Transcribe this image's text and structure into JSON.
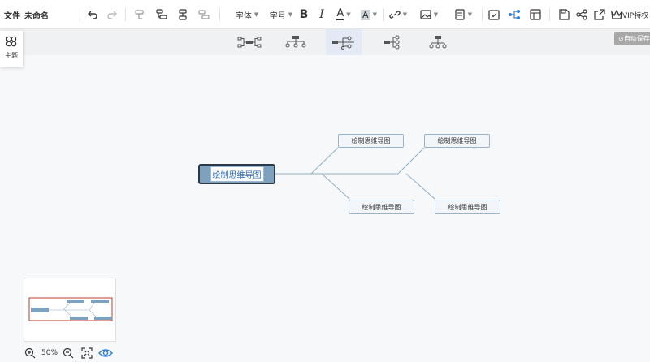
{
  "menu": {
    "file": "文件",
    "doc_title": "未命名"
  },
  "toolbar": {
    "font_label": "字体",
    "size_label": "字号",
    "bold": "B",
    "italic": "I",
    "font_color": "A",
    "highlight": "A",
    "vip_label": "VIP特权"
  },
  "layout_bar": {
    "autosave": "自动保存"
  },
  "theme_panel": {
    "label": "主题"
  },
  "mindmap": {
    "root": "绘制思维导图",
    "children": [
      "绘制思维导图",
      "绘制思维导图",
      "绘制思维导图",
      "绘制思维导图"
    ]
  },
  "zoom": {
    "level": "50%"
  },
  "colors": {
    "accent": "#2f7fd6",
    "root_fill": "#7ea2bd",
    "node_border": "#9ab4c6",
    "line": "#8fb0c4"
  }
}
